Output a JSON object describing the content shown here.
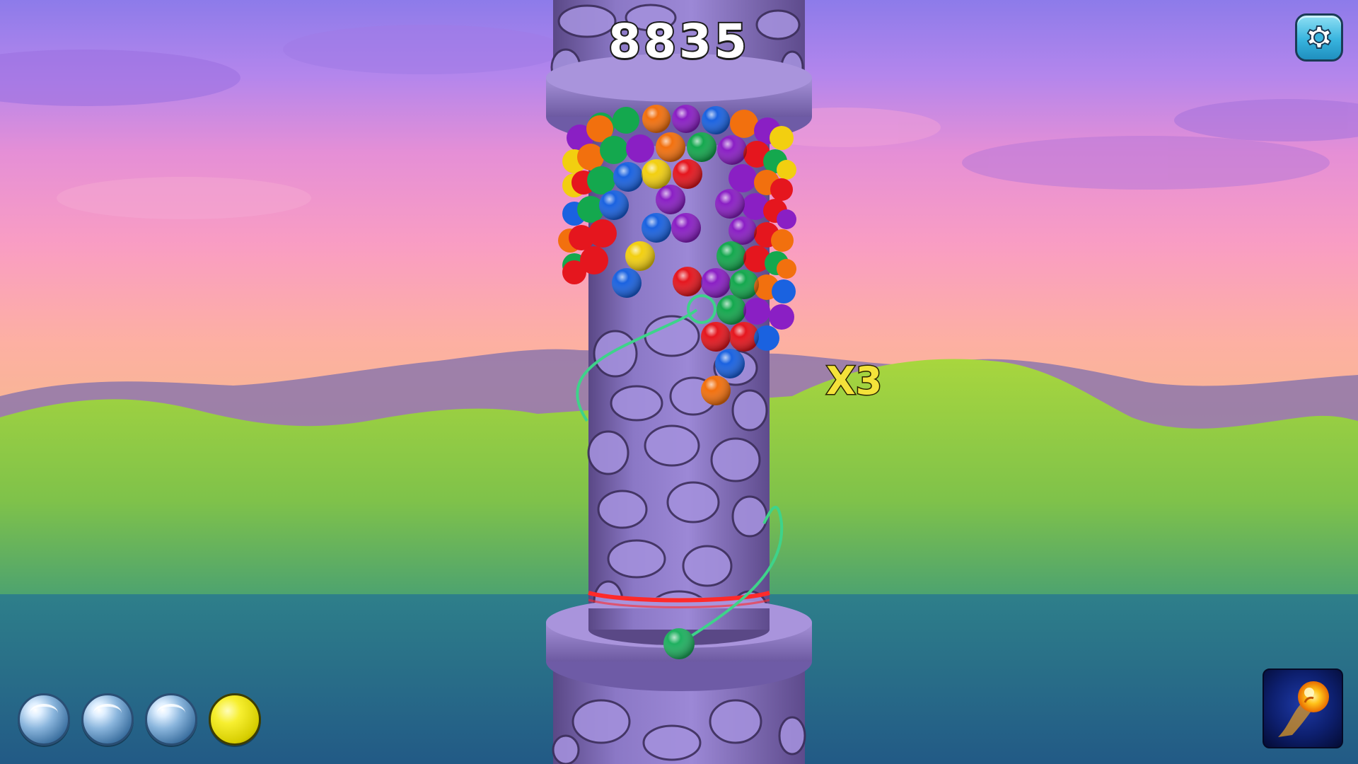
{
  "hud": {
    "score": "8835",
    "multiplier": "X3"
  },
  "settings": {
    "icon": "gear-icon"
  },
  "ball_queue": [
    {
      "state": "empty",
      "color": "#8bb6dd"
    },
    {
      "state": "empty",
      "color": "#8bb6dd"
    },
    {
      "state": "empty",
      "color": "#8bb6dd"
    },
    {
      "state": "filled",
      "color": "#f7ef30"
    }
  ],
  "powerup": {
    "icon": "fireball-icon"
  },
  "colors": {
    "tower": "#8f7ac9",
    "tower_dark": "#4a3b6e",
    "aim_line": "#3ed38a",
    "danger_line": "#ff2a2a",
    "current_ball": "#1fb060"
  },
  "ball_palette": {
    "red": "#e5161e",
    "green": "#14a84e",
    "blue": "#1a62e0",
    "yellow": "#f2cf10",
    "purple": "#8a1fc4",
    "orange": "#f2700e"
  }
}
